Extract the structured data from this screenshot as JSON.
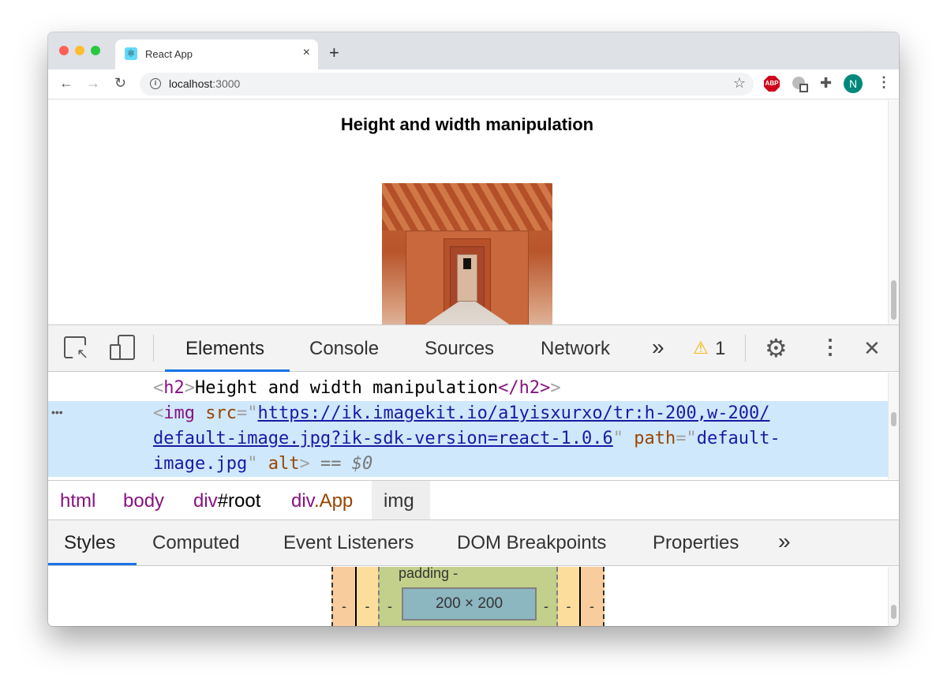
{
  "browser": {
    "tab_title": "React App",
    "tab_close": "×",
    "new_tab": "+",
    "url_host": "localhost",
    "url_port": ":3000",
    "extensions": {
      "abp": "ABP",
      "avatar": "N"
    }
  },
  "page": {
    "heading": "Height and width manipulation"
  },
  "devtools": {
    "tabs": [
      "Elements",
      "Console",
      "Sources",
      "Network"
    ],
    "more": "»",
    "warning_count": "1",
    "close": "✕",
    "elements": {
      "line1": {
        "open": "<",
        "tag": "h2",
        "close": ">",
        "text": "Height and width manipulation",
        "etag": "</h2>"
      },
      "ellipsis": "•••",
      "img_tag": "img",
      "src_attr": "src",
      "src_part1": "https://ik.imagekit.io/a1yisxurxo/tr:h-200,w-200/",
      "src_part2": "default-image.jpg?ik-sdk-version=react-1.0.6",
      "path_attr": "path",
      "path_val1": "default-",
      "path_val2": "image.jpg",
      "alt_attr": "alt",
      "selected_marker": "== $0"
    },
    "breadcrumbs": [
      {
        "tag": "html",
        "rest": ""
      },
      {
        "tag": "body",
        "rest": ""
      },
      {
        "tag": "div",
        "rest": "#root"
      },
      {
        "tag": "div",
        "rest": ".App"
      },
      {
        "tag": "img",
        "rest": ""
      }
    ],
    "subtabs": [
      "Styles",
      "Computed",
      "Event Listeners",
      "DOM Breakpoints",
      "Properties"
    ],
    "subtabs_more": "»",
    "box_model": {
      "padding_label": "padding -",
      "content": "200 × 200",
      "dash": "-"
    }
  },
  "colors": {
    "accent": "#1a73e8",
    "selected_row": "#cfe8fc",
    "margin": "#f9cc9d",
    "border": "#fddd9b",
    "padding": "#c3d08b",
    "content": "#8cb6c0"
  }
}
